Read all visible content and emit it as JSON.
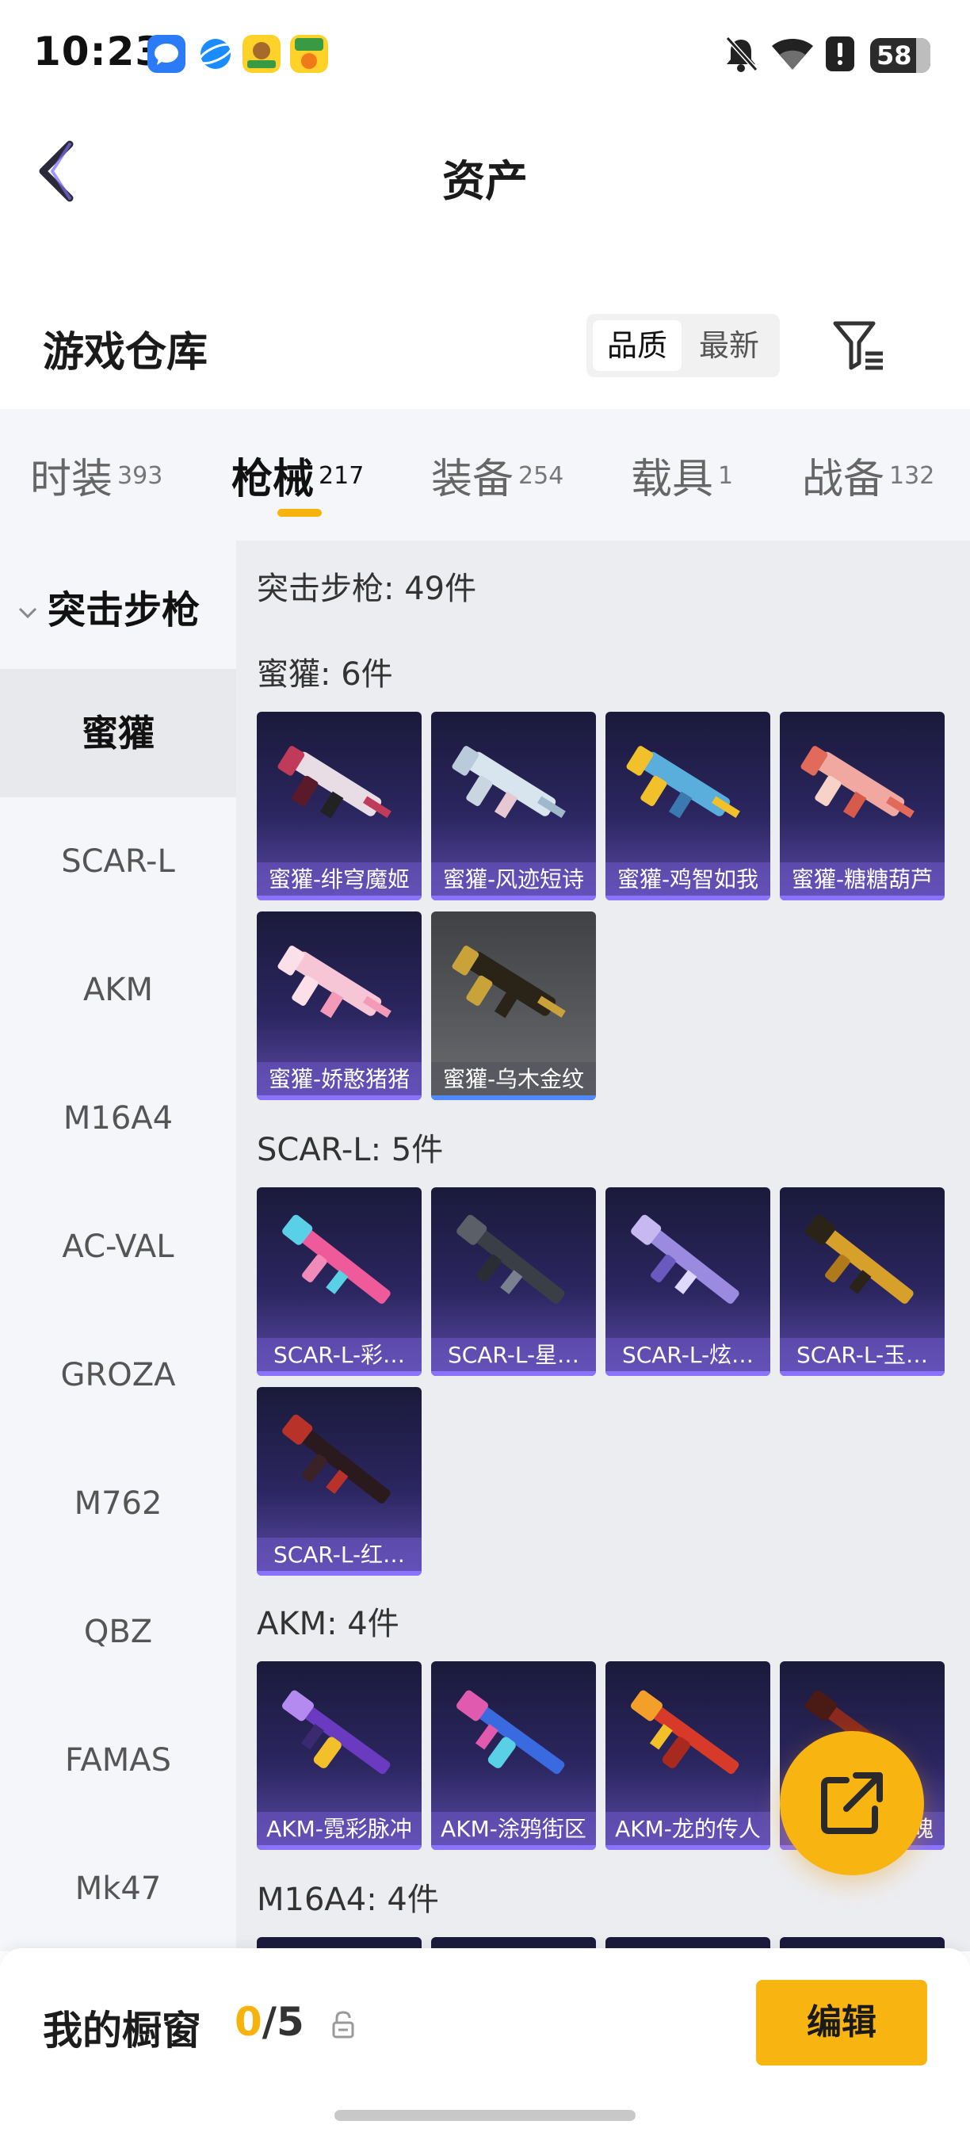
{
  "status_bar": {
    "time": "10:23",
    "battery": "58",
    "icons": [
      "app-bubble-icon",
      "app-browser-icon",
      "app-game-icon",
      "app-mima-icon",
      "mute-icon",
      "wifi-icon",
      "alert-icon",
      "battery-icon"
    ]
  },
  "header": {
    "title": "资产",
    "back_icon": "chevron-left-icon"
  },
  "warehouse": {
    "title": "游戏仓库",
    "sort_options": [
      "品质",
      "最新"
    ],
    "sort_selected": "品质",
    "filter_icon": "filter-icon"
  },
  "tabs": [
    {
      "label": "时装",
      "count": "393"
    },
    {
      "label": "枪械",
      "count": "217"
    },
    {
      "label": "装备",
      "count": "254"
    },
    {
      "label": "载具",
      "count": "1"
    },
    {
      "label": "战备",
      "count": "132"
    }
  ],
  "active_tab": "枪械",
  "sidebar": {
    "group": "突击步枪",
    "items": [
      "蜜獾",
      "SCAR-L",
      "AKM",
      "M16A4",
      "AC-VAL",
      "GROZA",
      "M762",
      "QBZ",
      "FAMAS",
      "Mk47"
    ],
    "active": "蜜獾"
  },
  "content": {
    "summary": "突击步枪: 49件",
    "sections": [
      {
        "label": "蜜獾: 6件",
        "items": [
          "蜜獾-绯穹魔姬",
          "蜜獾-风迹短诗",
          "蜜獾-鸡智如我",
          "蜜獾-糖糖葫芦",
          "蜜獾-娇憨猪猪",
          "蜜獾-乌木金纹"
        ]
      },
      {
        "label": "SCAR-L: 5件",
        "items": [
          "SCAR-L-彩…",
          "SCAR-L-星…",
          "SCAR-L-炫…",
          "SCAR-L-玉…",
          "SCAR-L-红…"
        ]
      },
      {
        "label": "AKM: 4件",
        "items": [
          "AKM-霓彩脉冲",
          "AKM-涂鸦街区",
          "AKM-龙的传人",
          "魄"
        ]
      },
      {
        "label": "M16A4: 4件",
        "items": []
      }
    ]
  },
  "fab_icon": "share-external-icon",
  "bottom_bar": {
    "label": "我的橱窗",
    "current": "0",
    "total": "/5",
    "lock_icon": "lock-icon",
    "edit_label": "编辑"
  },
  "colors": {
    "accent": "#f6b30d",
    "card_purple": "#2b2660",
    "card_grey": "#56585c"
  }
}
